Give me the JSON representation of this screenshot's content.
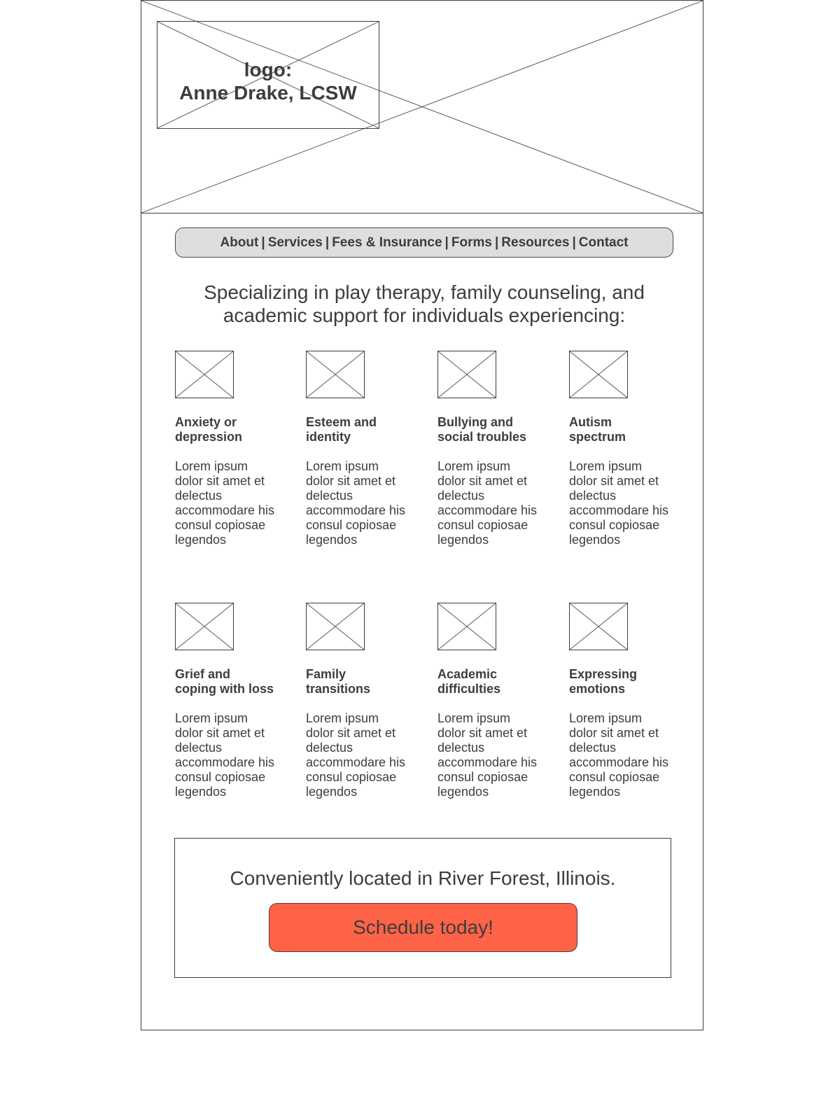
{
  "logo": {
    "line1": "logo:",
    "line2": "Anne Drake, LCSW"
  },
  "nav": {
    "items": [
      "About",
      "Services",
      "Fees & Insurance",
      "Forms",
      "Resources",
      "Contact"
    ],
    "separator": "|"
  },
  "headline": {
    "line1": "Specializing in play therapy, family counseling, and",
    "line2": "academic support for individuals experiencing:"
  },
  "services": [
    {
      "title1": "Anxiety or",
      "title2": "depression",
      "body": [
        "Lorem ipsum",
        "dolor sit amet et",
        "delectus",
        "accommodare his",
        "consul copiosae",
        "legendos"
      ]
    },
    {
      "title1": "Esteem and",
      "title2": "identity",
      "body": [
        "Lorem ipsum",
        "dolor sit amet et",
        "delectus",
        "accommodare his",
        "consul copiosae",
        "legendos"
      ]
    },
    {
      "title1": "Bullying and",
      "title2": "social troubles",
      "body": [
        "Lorem ipsum",
        "dolor sit amet et",
        "delectus",
        "accommodare his",
        "consul copiosae",
        "legendos"
      ]
    },
    {
      "title1": "Autism",
      "title2": "spectrum",
      "body": [
        "Lorem ipsum",
        "dolor sit amet et",
        "delectus",
        "accommodare his",
        "consul copiosae",
        "legendos"
      ]
    },
    {
      "title1": "Grief and",
      "title2": "coping with loss",
      "body": [
        "Lorem ipsum",
        "dolor sit amet et",
        "delectus",
        "accommodare his",
        "consul copiosae",
        "legendos"
      ]
    },
    {
      "title1": "Family",
      "title2": "transitions",
      "body": [
        "Lorem ipsum",
        "dolor sit amet et",
        "delectus",
        "accommodare his",
        "consul copiosae",
        "legendos"
      ]
    },
    {
      "title1": "Academic",
      "title2": "difficulties",
      "body": [
        "Lorem ipsum",
        "dolor sit amet et",
        "delectus",
        "accommodare his",
        "consul copiosae",
        "legendos"
      ]
    },
    {
      "title1": "Expressing",
      "title2": "emotions",
      "body": [
        "Lorem ipsum",
        "dolor sit amet et",
        "delectus",
        "accommodare his",
        "consul copiosae",
        "legendos"
      ]
    }
  ],
  "cta": {
    "location_text": "Conveniently located in River Forest, Illinois.",
    "button_label": "Schedule today!",
    "button_color": "#ff6347"
  },
  "colors": {
    "text": "#3d3d3d",
    "nav_bg": "#dedede"
  }
}
